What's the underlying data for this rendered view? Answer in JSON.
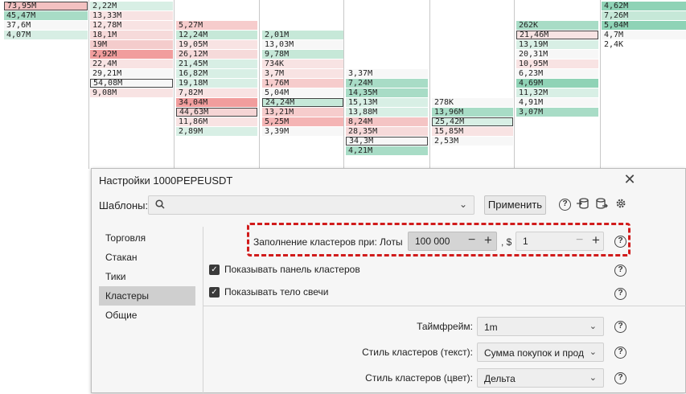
{
  "clusters": [
    {
      "col": 0,
      "rows": [
        {
          "text": "73,95M",
          "color": "#f3c1c1",
          "boxed": true
        },
        {
          "text": "45,47M",
          "color": "#a8dcc6"
        },
        {
          "text": "37,6M",
          "color": "#f7f7f7"
        },
        {
          "text": "4,07M",
          "color": "#d7eee4"
        }
      ]
    },
    {
      "col": 1,
      "rows": [
        {
          "text": "2,22M",
          "color": "#d8efe5"
        },
        {
          "text": "13,33M",
          "color": "#f8e3e3"
        },
        {
          "text": "12,78M",
          "color": "#f8e3e3"
        },
        {
          "text": "18,1M",
          "color": "#f6dada"
        },
        {
          "text": "19M",
          "color": "#f4cccc"
        },
        {
          "text": "2,92M",
          "color": "#f19d9d"
        },
        {
          "text": "22,4M",
          "color": "#f8e3e3"
        },
        {
          "text": "29,21M",
          "color": "#f7f7f7"
        },
        {
          "text": "54,08M",
          "color": "#f7f7f7",
          "boxed": true
        },
        {
          "text": "9,08M",
          "color": "#f8e3e3"
        }
      ]
    },
    {
      "col": 2,
      "rows": [
        {
          "text": "5,27M",
          "color": "#f6cccc"
        },
        {
          "text": "12,24M",
          "color": "#c6e8d8"
        },
        {
          "text": "19,05M",
          "color": "#f8e3e3"
        },
        {
          "text": "26,12M",
          "color": "#f6dada"
        },
        {
          "text": "21,45M",
          "color": "#d8efe5"
        },
        {
          "text": "16,82M",
          "color": "#d8efe5"
        },
        {
          "text": "19,18M",
          "color": "#d8efe5"
        },
        {
          "text": "7,82M",
          "color": "#f8e3e3"
        },
        {
          "text": "34,04M",
          "color": "#f19d9d"
        },
        {
          "text": "44,63M",
          "color": "#f5d5d5",
          "boxed": true
        },
        {
          "text": "11,86M",
          "color": "#f8e3e3"
        },
        {
          "text": "2,89M",
          "color": "#d8efe5"
        }
      ]
    },
    {
      "col": 3,
      "rows": [
        {
          "text": "2,01M",
          "color": "#c6e8d8"
        },
        {
          "text": "13,03M",
          "color": "#f7f7f7"
        },
        {
          "text": "9,78M",
          "color": "#c6e8d8"
        },
        {
          "text": "734K",
          "color": "#f8e3e3"
        },
        {
          "text": "3,7M",
          "color": "#f8e3e3"
        },
        {
          "text": "1,76M",
          "color": "#f6cccc"
        },
        {
          "text": "5,04M",
          "color": "#f7f7f7"
        },
        {
          "text": "24,24M",
          "color": "#c6e8d8",
          "boxed": true
        },
        {
          "text": "13,21M",
          "color": "#f6cccc"
        },
        {
          "text": "5,25M",
          "color": "#f4b4b4"
        },
        {
          "text": "3,39M",
          "color": "#f7f7f7"
        }
      ]
    },
    {
      "col": 4,
      "rows": [
        {
          "text": "3,37M",
          "color": "#f7f7f7"
        },
        {
          "text": "7,24M",
          "color": "#a8dcc6"
        },
        {
          "text": "14,35M",
          "color": "#a8dcc6"
        },
        {
          "text": "15,13M",
          "color": "#d8efe5"
        },
        {
          "text": "13,88M",
          "color": "#d8efe5"
        },
        {
          "text": "8,24M",
          "color": "#f4c4c4"
        },
        {
          "text": "28,35M",
          "color": "#f6dada"
        },
        {
          "text": "34,3M",
          "color": "#f7f7f7",
          "boxed": true
        },
        {
          "text": "4,21M",
          "color": "#a8dcc6"
        }
      ]
    },
    {
      "col": 5,
      "rows": [
        {
          "text": "278K",
          "color": "#f7f7f7"
        },
        {
          "text": "13,96M",
          "color": "#a8dcc6"
        },
        {
          "text": "25,42M",
          "color": "#d8efe5",
          "boxed": true
        },
        {
          "text": "15,85M",
          "color": "#f8e3e3"
        },
        {
          "text": "2,53M",
          "color": "#f7f7f7"
        }
      ]
    },
    {
      "col": 6,
      "rows": [
        {
          "text": "262K",
          "color": "#a8dcc6"
        },
        {
          "text": "21,46M",
          "color": "#f8e3e3",
          "boxed": true
        },
        {
          "text": "13,19M",
          "color": "#d8efe5"
        },
        {
          "text": "20,31M",
          "color": "#f7f7f7"
        },
        {
          "text": "10,95M",
          "color": "#f8e3e3"
        },
        {
          "text": "6,23M",
          "color": "#f7f7f7"
        },
        {
          "text": "4,69M",
          "color": "#8fd3b6"
        },
        {
          "text": "11,32M",
          "color": "#d8efe5"
        },
        {
          "text": "4,91M",
          "color": "#f7f7f7"
        },
        {
          "text": "3,07M",
          "color": "#a8dcc6"
        }
      ]
    },
    {
      "col": 7,
      "rows": [
        {
          "text": "4,62M",
          "color": "#8fd3b6"
        },
        {
          "text": "7,26M",
          "color": "#c6e8d8"
        },
        {
          "text": "5,04M",
          "color": "#8fd3b6"
        },
        {
          "text": "4,7M",
          "color": "#f7f7f7"
        },
        {
          "text": "2,4K",
          "color": "#ffffff"
        }
      ]
    }
  ],
  "dialog": {
    "title": "Настройки 1000PEPEUSDT",
    "close": "✕",
    "templates_label": "Шаблоны:",
    "search_icon": "search-icon",
    "apply": "Применить",
    "nav": [
      "Торговля",
      "Стакан",
      "Тики",
      "Кластеры",
      "Общие"
    ],
    "active_nav": "Кластеры",
    "fill": {
      "label": "Заполнение кластеров при: Лоты",
      "lots_value": "100 000",
      "sep": ", $",
      "usd_value": "1"
    },
    "checks": [
      {
        "label": "Показывать панель кластеров",
        "checked": true
      },
      {
        "label": "Показывать тело свечи",
        "checked": true
      }
    ],
    "fields": [
      {
        "label": "Таймфрейм:",
        "value": "1m"
      },
      {
        "label": "Стиль кластеров (текст):",
        "value": "Сумма покупок и продаж"
      },
      {
        "label": "Стиль кластеров (цвет):",
        "value": "Дельта"
      }
    ],
    "help": "?"
  }
}
